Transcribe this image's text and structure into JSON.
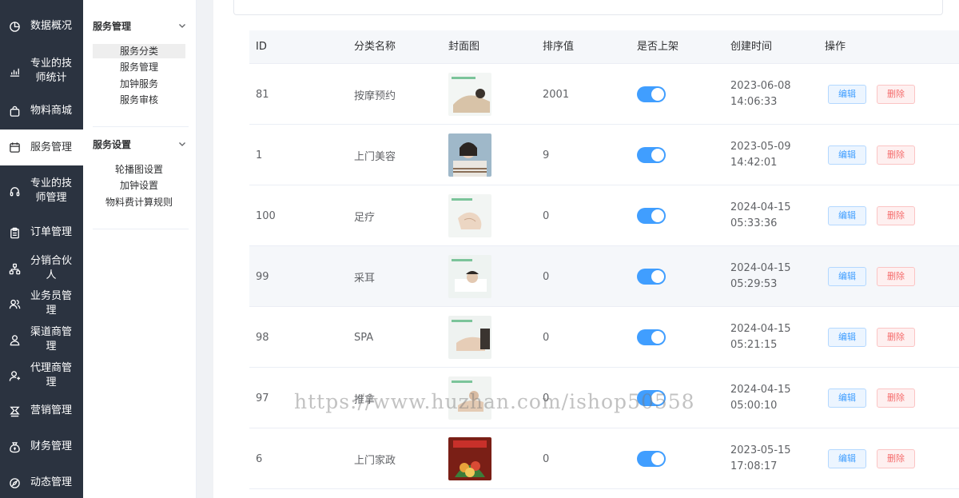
{
  "sidebar": {
    "items": [
      {
        "label": "数据概况",
        "icon": "pie-chart-icon"
      },
      {
        "label": "专业的技师统计",
        "icon": "bar-chart-icon"
      },
      {
        "label": "物料商城",
        "icon": "shopping-bag-icon"
      },
      {
        "label": "服务管理",
        "icon": "calendar-icon",
        "active": true
      },
      {
        "label": "专业的技师管理",
        "icon": "headset-icon"
      },
      {
        "label": "订单管理",
        "icon": "clipboard-icon"
      },
      {
        "label": "分销合伙人",
        "icon": "network-icon"
      },
      {
        "label": "业务员管理",
        "icon": "users-icon"
      },
      {
        "label": "渠道商管理",
        "icon": "user-check-icon"
      },
      {
        "label": "代理商管理",
        "icon": "agent-icon"
      },
      {
        "label": "营销管理",
        "icon": "marketing-icon"
      },
      {
        "label": "财务管理",
        "icon": "money-bag-icon"
      },
      {
        "label": "动态管理",
        "icon": "compass-icon"
      }
    ]
  },
  "submenu": {
    "groups": [
      {
        "title": "服务管理",
        "items": [
          "服务分类",
          "服务管理",
          "加钟服务",
          "服务审核"
        ],
        "active_index": 0
      },
      {
        "title": "服务设置",
        "items": [
          "轮播图设置",
          "加钟设置",
          "物料费计算规则"
        ]
      }
    ]
  },
  "table": {
    "headers": [
      "ID",
      "分类名称",
      "封面图",
      "排序值",
      "是否上架",
      "创建时间",
      "操作"
    ],
    "edit_label": "编辑",
    "delete_label": "删除",
    "rows": [
      {
        "id": "81",
        "name": "按摩预约",
        "sort": "2001",
        "on_shelf": true,
        "date": "2023-06-08",
        "time": "14:06:33"
      },
      {
        "id": "1",
        "name": "上门美容",
        "sort": "9",
        "on_shelf": true,
        "date": "2023-05-09",
        "time": "14:42:01"
      },
      {
        "id": "100",
        "name": "足疗",
        "sort": "0",
        "on_shelf": true,
        "date": "2024-04-15",
        "time": "05:33:36"
      },
      {
        "id": "99",
        "name": "采耳",
        "sort": "0",
        "on_shelf": true,
        "date": "2024-04-15",
        "time": "05:29:53"
      },
      {
        "id": "98",
        "name": "SPA",
        "sort": "0",
        "on_shelf": true,
        "date": "2024-04-15",
        "time": "05:21:15"
      },
      {
        "id": "97",
        "name": "推拿",
        "sort": "0",
        "on_shelf": true,
        "date": "2024-04-15",
        "time": "05:00:10"
      },
      {
        "id": "6",
        "name": "上门家政",
        "sort": "0",
        "on_shelf": true,
        "date": "2023-05-15",
        "time": "17:08:17"
      }
    ]
  },
  "watermark": "https://www.huzhan.com/ishop50558",
  "colors": {
    "sidebar_bg": "#2b3340",
    "primary": "#409eff",
    "danger": "#f56c6c",
    "header_bg": "#f5f7fa"
  }
}
